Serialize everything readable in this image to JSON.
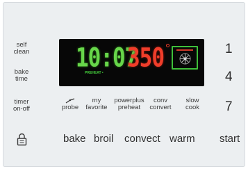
{
  "left_column": {
    "self_clean": [
      "self",
      "clean"
    ],
    "bake_time": [
      "bake",
      "time"
    ],
    "timer_on_off": [
      "timer",
      "on-off"
    ]
  },
  "display": {
    "clock": "10:07",
    "temperature": "350",
    "indicator": "PREHEAT •"
  },
  "keypad": [
    "1",
    "4",
    "7"
  ],
  "mid_row": {
    "probe": "probe",
    "my_favorite": [
      "my",
      "favorite"
    ],
    "powerplus_preheat": [
      "powerplus",
      "preheat"
    ],
    "conv_convert": [
      "conv",
      "convert"
    ],
    "slow_cook": [
      "slow",
      "cook"
    ]
  },
  "bottom_row": {
    "bake": "bake",
    "broil": "broil",
    "convect": "convect",
    "warm": "warm",
    "start": "start"
  },
  "colors": {
    "panel": "#eceff1",
    "clock_green": "#67d64a",
    "temp_red": "#ef3d2a",
    "display_bg": "#070707"
  },
  "icons": [
    "lock-icon",
    "probe-icon",
    "convection-fan-icon"
  ]
}
